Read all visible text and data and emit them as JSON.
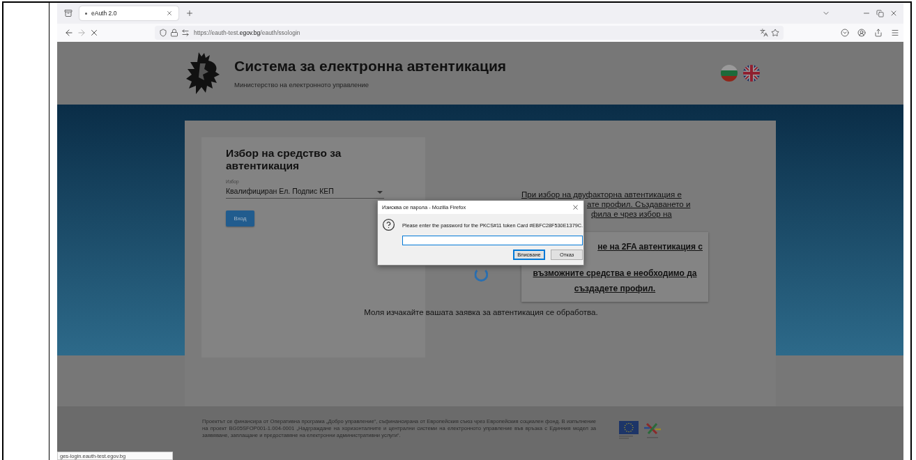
{
  "browser": {
    "tabs": [
      {
        "title": "eAuth 2.0",
        "selected": true
      }
    ],
    "url": {
      "prefix": "https://eauth-test.",
      "domain": "egov.bg",
      "path": "/eauth/ssologin"
    },
    "status_url": "ges-login.eauth-test.egov.bg"
  },
  "header": {
    "title": "Система за електронна автентикация",
    "subtitle": "Министерство на електронното управление",
    "languages": [
      {
        "kind": "bg"
      },
      {
        "kind": "en"
      }
    ]
  },
  "login": {
    "heading": "Избор на средство за автентикация",
    "select_label": "Избор",
    "select_value": "Квалифициран Ел. Подпис КЕП",
    "button": "Вход"
  },
  "info_lines": [
    "При избор на двуфакторна автентикация е",
    "ате профил. Създаването и",
    "фила е чрез избор на"
  ],
  "twofa_lines": [
    "не на 2FA автентикация с",
    "възможните средства е необходимо да",
    "създадете профил."
  ],
  "wait_message": "Моля изчакайте вашата заявка за автентикация се обработва.",
  "dialog": {
    "title": "Изисква се парола - Mozilla Firefox",
    "message": "Please enter the password for the PKCS#11 token Card #EBFC28F530E1379C.",
    "buttons": [
      {
        "label": "Вписване",
        "selected": true
      },
      {
        "label": "Отказ",
        "selected": false
      }
    ]
  },
  "footer": {
    "text": "Проектът се финансира от Оперативна програма „Добро управление“, съфинансирана от Европейския съюз чрез Европейския социален фонд. В изпълнение на проект BG05SFOP001-1.004-0001 „Надграждане на хоризонталните и централни системи на електронното управление във връзка с Единния модел за заявяване, заплащане и предоставяне на електронни административни услуги“."
  }
}
